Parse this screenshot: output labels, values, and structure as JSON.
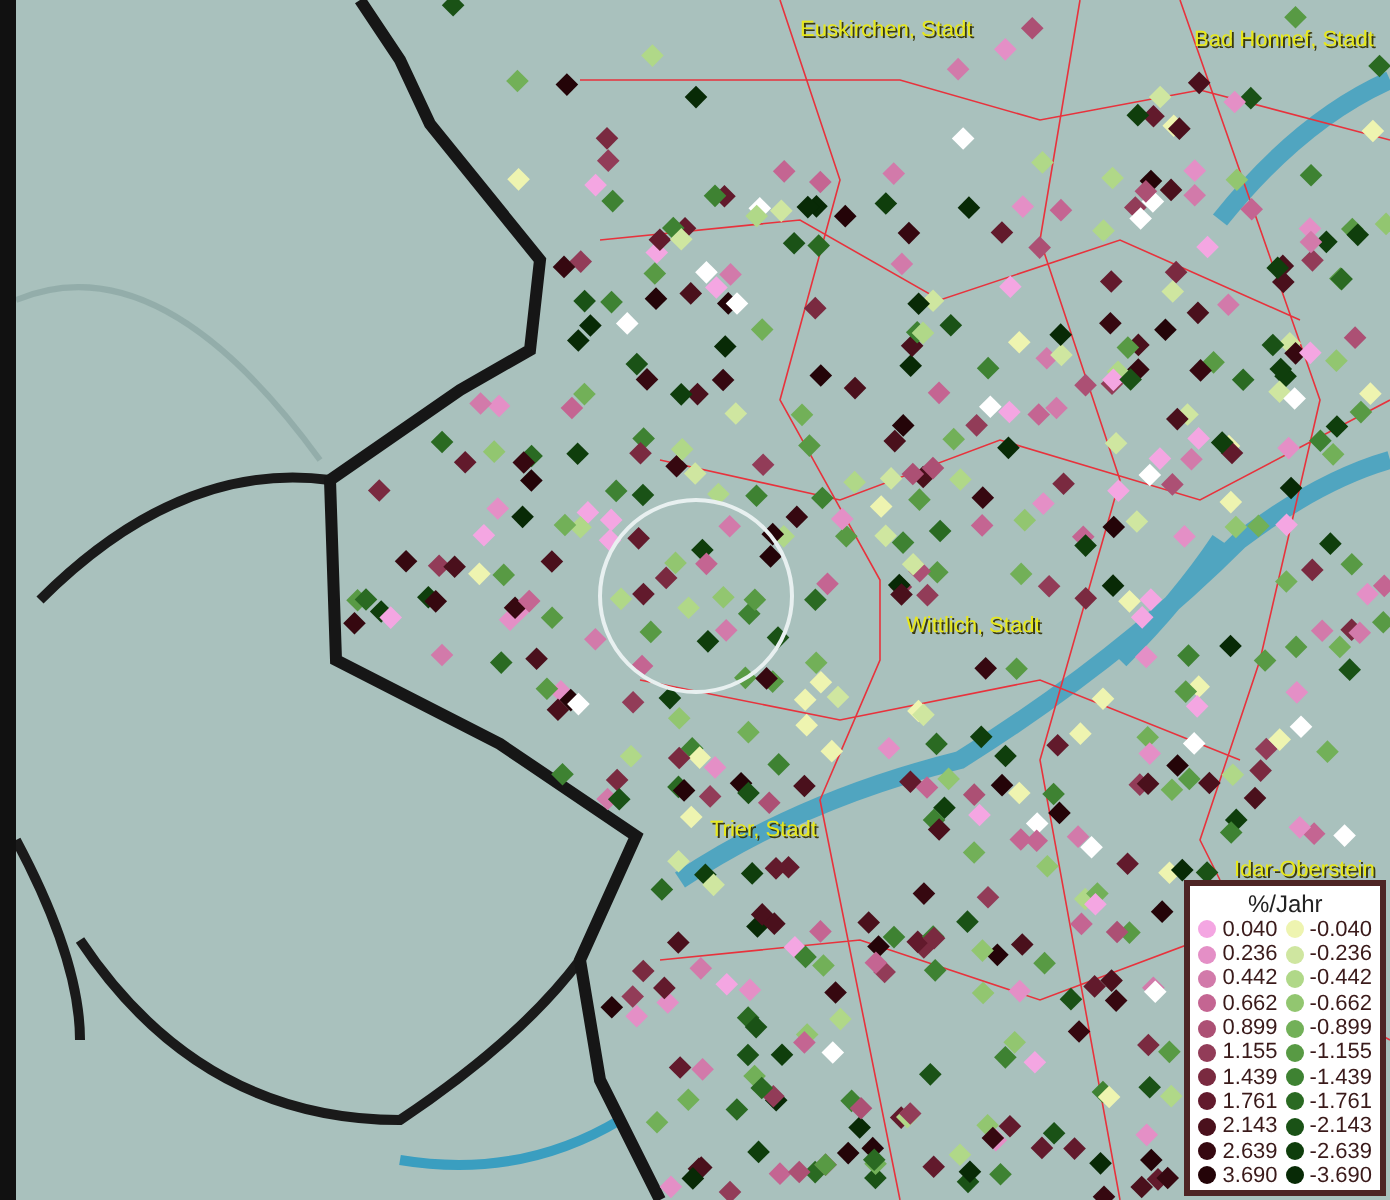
{
  "map": {
    "place_labels": [
      {
        "text": "Euskirchen, Stadt"
      },
      {
        "text": "Bad Honnef, Stadt"
      },
      {
        "text": "Wittlich, Stadt"
      },
      {
        "text": "Trier, Stadt"
      },
      {
        "text": "Idar-Oberstein"
      }
    ]
  },
  "legend": {
    "title": "%/Jahr",
    "rows": [
      [
        {
          "value": "0.040",
          "color": "#f4a6e2"
        },
        {
          "value": "-0.040",
          "color": "#eef4b0"
        }
      ],
      [
        {
          "value": "0.236",
          "color": "#e48fc6"
        },
        {
          "value": "-0.236",
          "color": "#cfe6a0"
        }
      ],
      [
        {
          "value": "0.442",
          "color": "#d27aaa"
        },
        {
          "value": "-0.442",
          "color": "#b0d888"
        }
      ],
      [
        {
          "value": "0.662",
          "color": "#c46592"
        },
        {
          "value": "-0.662",
          "color": "#92c670"
        }
      ],
      [
        {
          "value": "0.899",
          "color": "#ac5074"
        },
        {
          "value": "-0.899",
          "color": "#72b058"
        }
      ],
      [
        {
          "value": "1.155",
          "color": "#923c58"
        },
        {
          "value": "-1.155",
          "color": "#589a44"
        }
      ],
      [
        {
          "value": "1.439",
          "color": "#7a2a40"
        },
        {
          "value": "-1.439",
          "color": "#3e8232"
        }
      ],
      [
        {
          "value": "1.761",
          "color": "#621a2c"
        },
        {
          "value": "-1.761",
          "color": "#2a6a22"
        }
      ],
      [
        {
          "value": "2.143",
          "color": "#4a101c"
        },
        {
          "value": "-2.143",
          "color": "#1a5216"
        }
      ],
      [
        {
          "value": "2.639",
          "color": "#360810"
        },
        {
          "value": "-2.639",
          "color": "#0f3e0c"
        }
      ],
      [
        {
          "value": "3.690",
          "color": "#240408"
        },
        {
          "value": "-3.690",
          "color": "#082a06"
        }
      ]
    ]
  }
}
